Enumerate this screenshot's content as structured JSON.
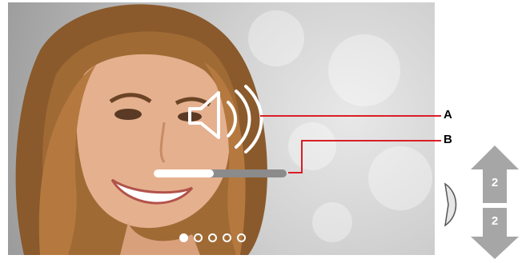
{
  "callouts": {
    "a": "A",
    "b": "B"
  },
  "volume": {
    "level": 0.45
  },
  "pager": {
    "count": 5,
    "active_index": 0
  },
  "nav": {
    "up_label": "2",
    "down_label": "2"
  },
  "icons": {
    "speaker": "speaker-volume-icon",
    "side_tab": "chevron-right-icon",
    "up": "arrow-up-icon",
    "down": "arrow-down-icon"
  },
  "colors": {
    "callout_line": "#d91f26",
    "arrow_grey": "#a6a6a6",
    "volume_fill": "#ffffff",
    "volume_track": "#8b8b8b"
  }
}
